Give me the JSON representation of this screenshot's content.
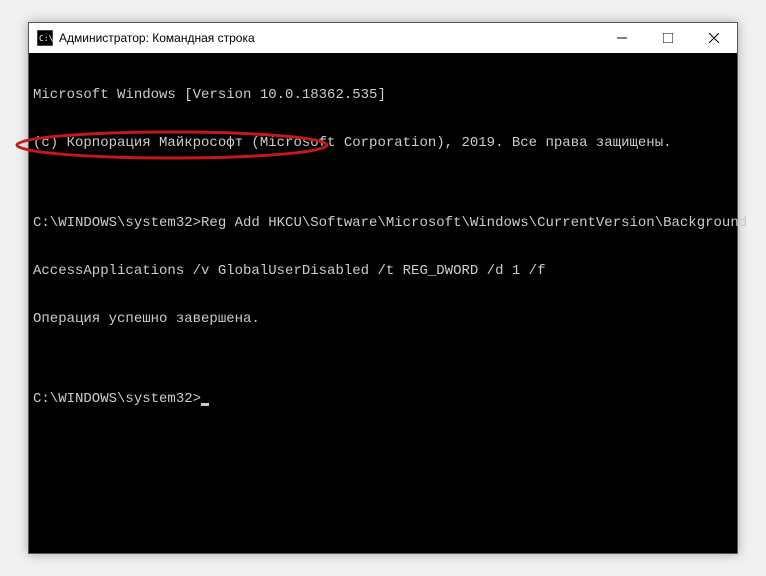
{
  "titlebar": {
    "title": "Администратор: Командная строка"
  },
  "console": {
    "line1": "Microsoft Windows [Version 10.0.18362.535]",
    "line2": "(c) Корпорация Майкрософт (Microsoft Corporation), 2019. Все права защищены.",
    "blank1": "",
    "line3": "C:\\WINDOWS\\system32>Reg Add HKCU\\Software\\Microsoft\\Windows\\CurrentVersion\\Background",
    "line4": "AccessApplications /v GlobalUserDisabled /t REG_DWORD /d 1 /f",
    "line5": "Операция успешно завершена.",
    "blank2": "",
    "prompt": "C:\\WINDOWS\\system32>"
  },
  "annotation": {
    "color": "#c41919"
  }
}
